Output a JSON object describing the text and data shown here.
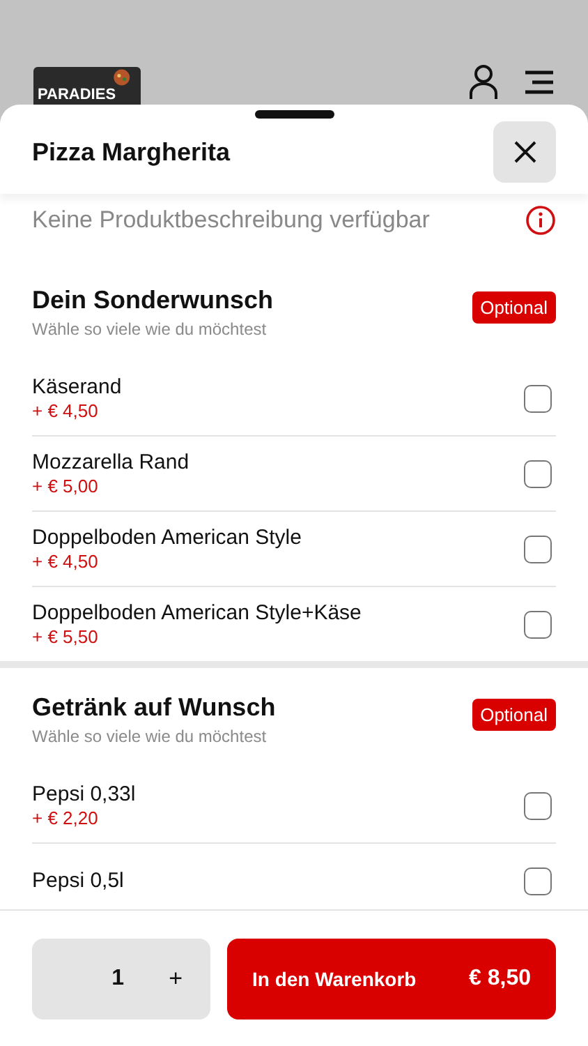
{
  "background_header": {
    "logo_text": "PARADIES"
  },
  "sheet": {
    "title": "Pizza Margherita",
    "description": "Keine Produktbeschreibung verfügbar",
    "groups": [
      {
        "title": "Dein Sonderwunsch",
        "subtitle": "Wähle so viele wie du möchtest",
        "badge": "Optional",
        "options": [
          {
            "name": "Käserand",
            "price": "+ € 4,50",
            "checked": false
          },
          {
            "name": "Mozzarella Rand",
            "price": "+ € 5,00",
            "checked": false
          },
          {
            "name": "Doppelboden American Style",
            "price": "+ € 4,50",
            "checked": false
          },
          {
            "name": "Doppelboden American Style+Käse",
            "price": "+ € 5,50",
            "checked": false
          }
        ]
      },
      {
        "title": "Getränk auf Wunsch",
        "subtitle": "Wähle so viele wie du möchtest",
        "badge": "Optional",
        "options": [
          {
            "name": "Pepsi 0,33l",
            "price": "+ € 2,20",
            "checked": false
          },
          {
            "name": "Pepsi 0,5l",
            "checked": false
          }
        ]
      }
    ]
  },
  "footer": {
    "quantity": "1",
    "increment": "+",
    "cart_button": {
      "label": "In den Warenkorb",
      "price": "€ 8,50"
    }
  }
}
